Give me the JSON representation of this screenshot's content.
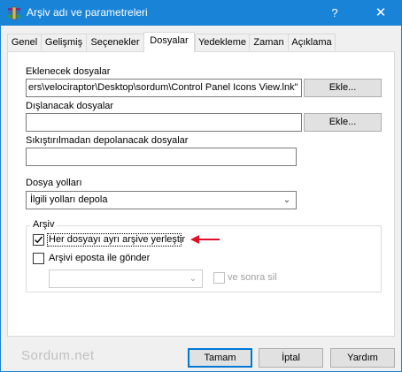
{
  "window": {
    "title": "Arşiv adı ve parametreleri",
    "help_glyph": "?",
    "close_glyph": "✕",
    "titlebar_color": "#1883d7",
    "app_icon": "winrar-books-icon"
  },
  "tabs": [
    {
      "label": "Genel",
      "active": false
    },
    {
      "label": "Gelişmiş",
      "active": false
    },
    {
      "label": "Seçenekler",
      "active": false
    },
    {
      "label": "Dosyalar",
      "active": true
    },
    {
      "label": "Yedekleme",
      "active": false
    },
    {
      "label": "Zaman",
      "active": false
    },
    {
      "label": "Açıklama",
      "active": false
    }
  ],
  "files": {
    "add_label": "Eklenecek dosyalar",
    "add_value": "ers\\velociraptor\\Desktop\\sordum\\Control Panel Icons View.lnk\"",
    "add_button": "Ekle...",
    "exclude_label": "Dışlanacak dosyalar",
    "exclude_value": "",
    "exclude_button": "Ekle...",
    "store_label": "Sıkıştırılmadan depolanacak dosyalar",
    "store_value": ""
  },
  "paths": {
    "label": "Dosya yolları",
    "selected": "İlgili yolları depola"
  },
  "archive_group": {
    "legend": "Arşiv",
    "separate_label": "Her dosyayı ayrı arşive yerleştir",
    "separate_checked": true,
    "email_label": "Arşivi eposta ile gönder",
    "email_checked": false,
    "email_combo_value": "",
    "delete_after_label": "ve sonra sil",
    "delete_after_checked": false
  },
  "annotation": {
    "arrow_color": "#e0102a"
  },
  "footer": {
    "watermark": "Sordum.net",
    "ok": "Tamam",
    "cancel": "İptal",
    "help": "Yardım"
  }
}
